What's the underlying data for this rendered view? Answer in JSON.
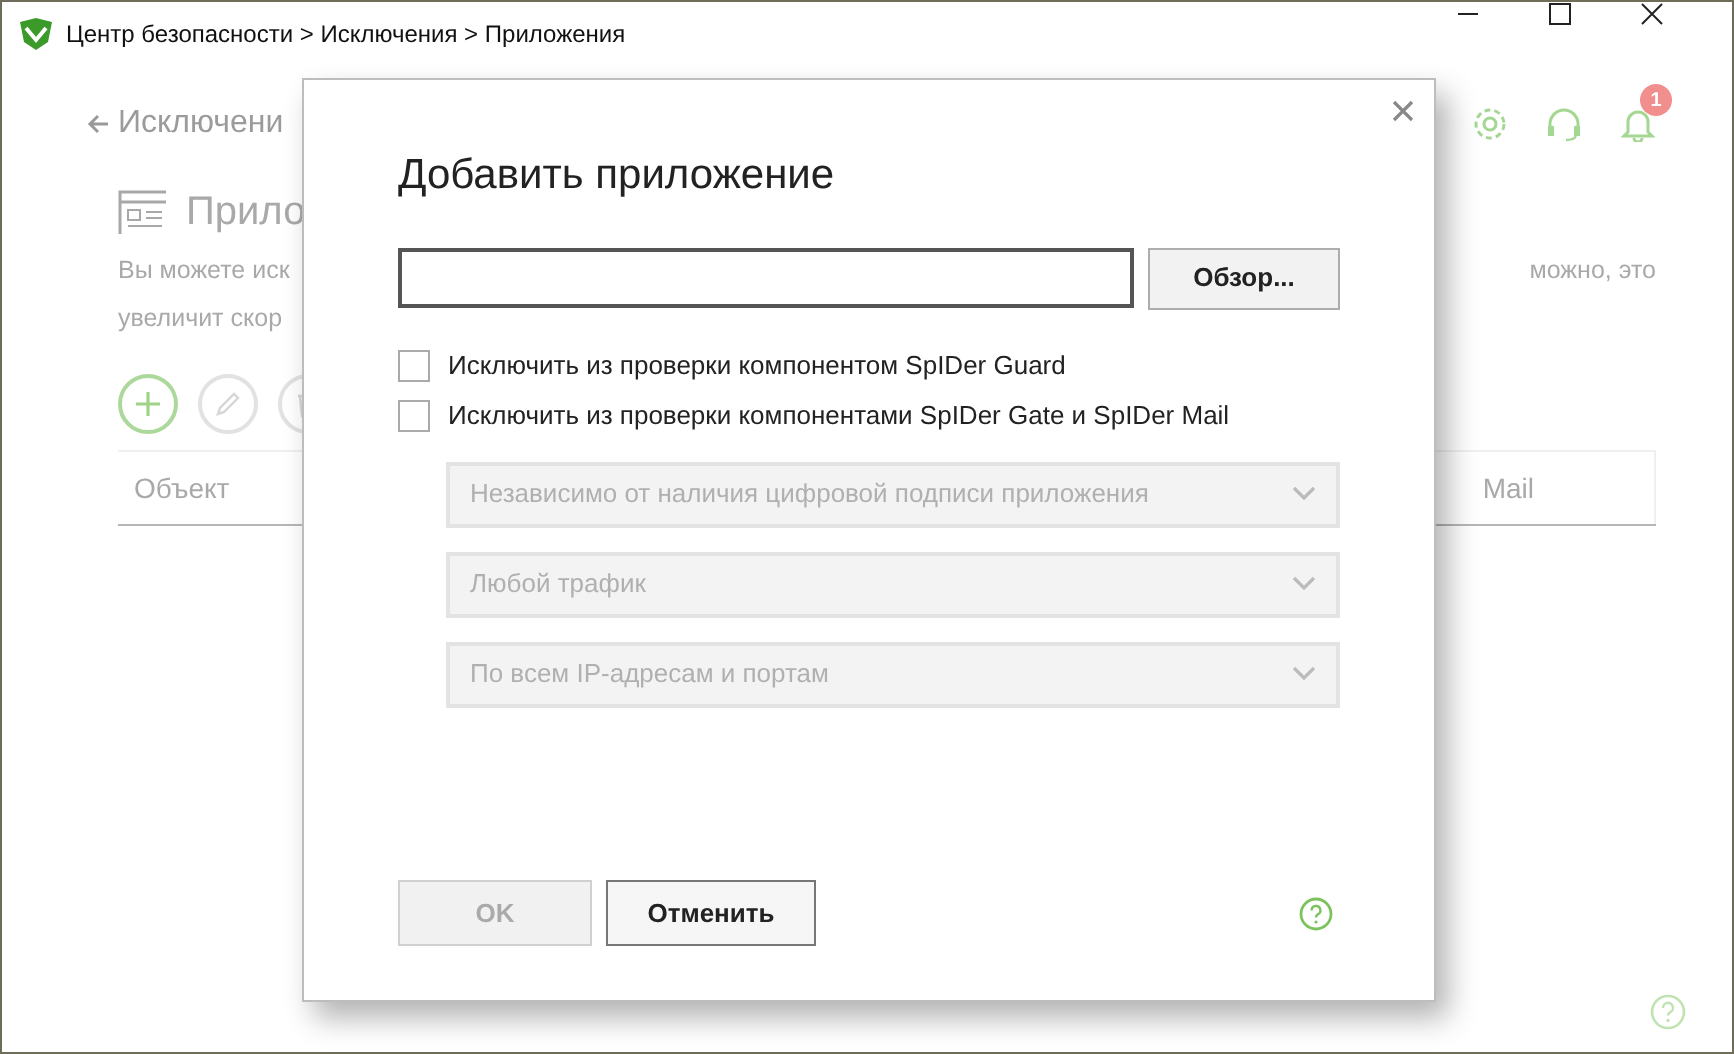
{
  "window": {
    "title": "Центр безопасности > Исключения > Приложения"
  },
  "header": {
    "notification_count": "1"
  },
  "page": {
    "back_link": "Исключени",
    "title": "Прило",
    "description_left": [
      "Вы можете иск",
      "увеличит скор"
    ],
    "description_right": "можно, это",
    "toolbar_buttons": [
      {
        "kind": "add",
        "disabled": false
      },
      {
        "kind": "edit",
        "disabled": true
      },
      {
        "kind": "delete",
        "disabled": true
      }
    ],
    "table": {
      "columns": [
        "Объект",
        "Mail"
      ]
    }
  },
  "dialog": {
    "title": "Добавить приложение",
    "browse_button": "Обзор...",
    "checkboxes": [
      {
        "label": "Исключить из проверки компонентом SpIDer Guard",
        "checked": false
      },
      {
        "label": "Исключить из проверки компонентами SpIDer Gate и SpIDer Mail",
        "checked": false
      }
    ],
    "dropdowns": [
      {
        "value": "Независимо от наличия цифровой подписи приложения",
        "disabled": true
      },
      {
        "value": "Любой трафик",
        "disabled": true
      },
      {
        "value": "По всем IP-адресам и портам",
        "disabled": true
      }
    ],
    "buttons": [
      {
        "label": "OK",
        "disabled": true
      },
      {
        "label": "Отменить",
        "disabled": false
      }
    ]
  }
}
